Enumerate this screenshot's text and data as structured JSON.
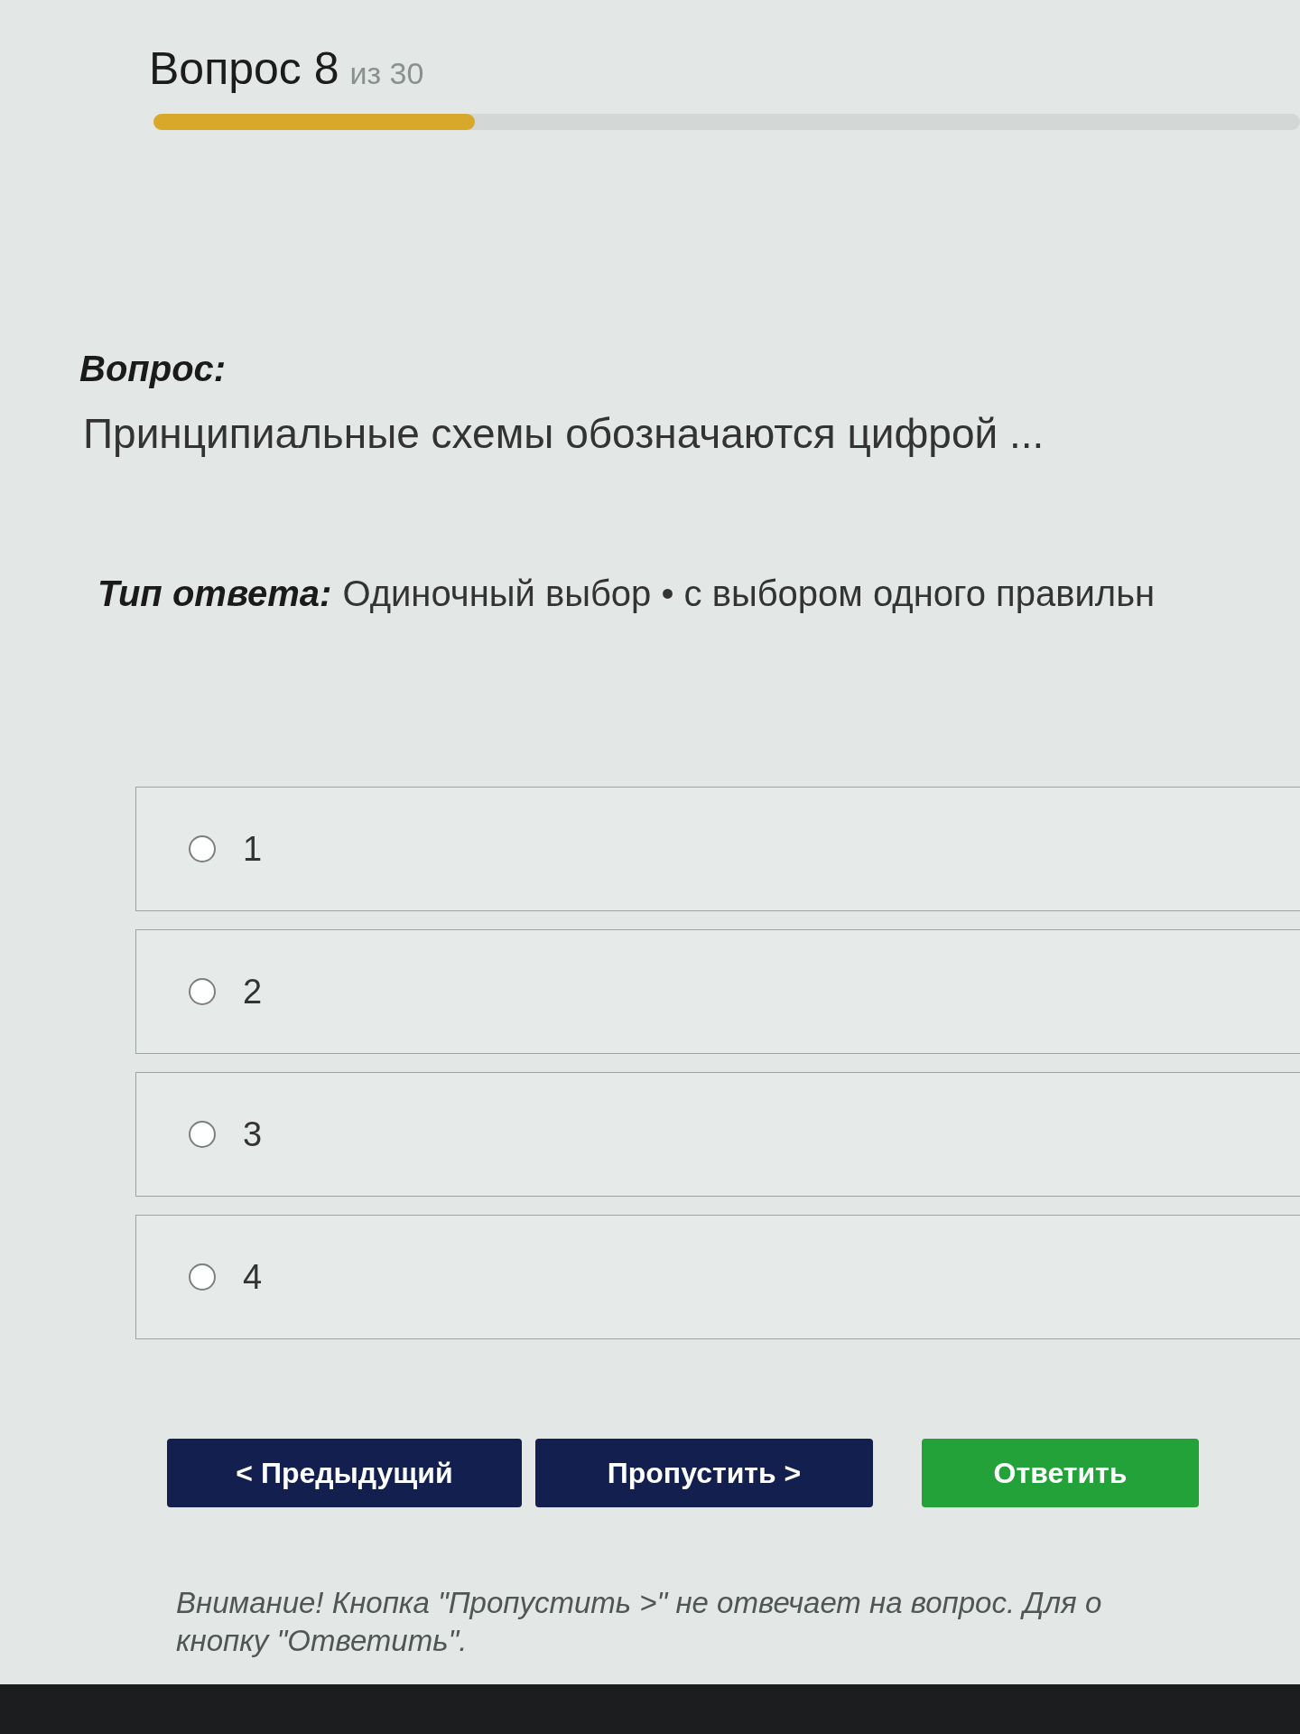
{
  "header": {
    "title": "Вопрос 8",
    "counter": "из 30",
    "progress": {
      "level": 0.28
    }
  },
  "question": {
    "label": "Вопрос:",
    "text": "Принципиальные схемы обозначаются цифрой ..."
  },
  "answer_type": {
    "label": "Тип ответа:",
    "value": "Одиночный выбор • с выбором одного правильн"
  },
  "options": [
    {
      "label": "1",
      "selected": false
    },
    {
      "label": "2",
      "selected": false
    },
    {
      "label": "3",
      "selected": false
    },
    {
      "label": "4",
      "selected": false
    }
  ],
  "buttons": [
    {
      "kind": "nav",
      "label": "< Предыдущий"
    },
    {
      "kind": "nav",
      "label": "Пропустить >"
    },
    {
      "kind": "primary",
      "label": "Ответить"
    }
  ],
  "warning": {
    "lines": [
      "Внимание! Кнопка \"Пропустить >\" не отвечает на вопрос. Для о",
      "кнопку \"Ответить\"."
    ]
  }
}
